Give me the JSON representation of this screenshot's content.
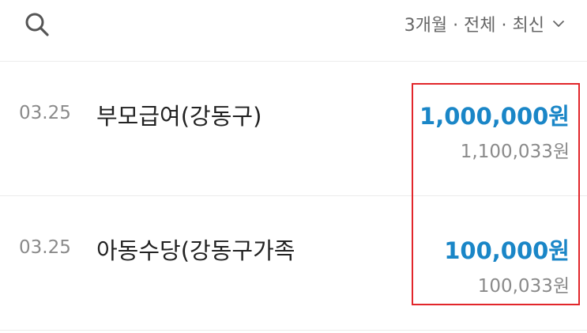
{
  "filter": {
    "label": "3개월 · 전체 · 최신"
  },
  "transactions": [
    {
      "date": "03.25",
      "title": "부모급여(강동구)",
      "amount": "1,000,000원",
      "balance": "1,100,033원"
    },
    {
      "date": "03.25",
      "title": "아동수당(강동구가족",
      "amount": "100,000원",
      "balance": "100,033원"
    }
  ],
  "colors": {
    "amount": "#1a86c7",
    "highlight": "#e2262b",
    "muted_text": "#8a8a8a",
    "divider": "#ececec"
  },
  "icons": {
    "search": "search-icon",
    "dropdown": "chevron-down-icon"
  }
}
